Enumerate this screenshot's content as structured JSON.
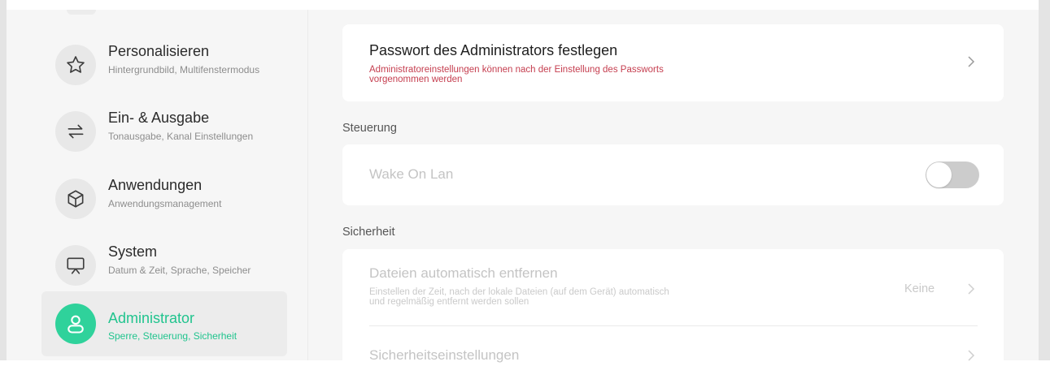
{
  "sidebar": {
    "items": [
      {
        "title": "Personalisieren",
        "subtitle": "Hintergrundbild, Multifenstermodus",
        "icon": "star-icon"
      },
      {
        "title": "Ein- & Ausgabe",
        "subtitle": "Tonausgabe, Kanal Einstellungen",
        "icon": "swap-arrows-icon"
      },
      {
        "title": "Anwendungen",
        "subtitle": "Anwendungsmanagement",
        "icon": "cube-icon"
      },
      {
        "title": "System",
        "subtitle": "Datum & Zeit, Sprache, Speicher",
        "icon": "presentation-screen-icon"
      },
      {
        "title": "Administrator",
        "subtitle": "Sperre, Steuerung, Sicherheit",
        "icon": "user-icon",
        "active": true
      }
    ]
  },
  "main": {
    "password_card": {
      "title": "Passwort des Administrators festlegen",
      "description": "Administratoreinstellungen können nach der Einstellung des Passworts vorgenommen werden"
    },
    "control_section": {
      "label": "Steuerung",
      "wake_on_lan": {
        "label": "Wake On Lan",
        "enabled": false
      }
    },
    "security_section": {
      "label": "Sicherheit",
      "auto_delete": {
        "title": "Dateien automatisch entfernen",
        "description": "Einstellen der Zeit, nach der lokale Dateien (auf dem Gerät) automatisch und regelmäßig entfernt werden sollen",
        "value": "Keine"
      },
      "security_settings": {
        "title": "Sicherheitseinstellungen"
      }
    }
  },
  "colors": {
    "accent": "#2fd29b",
    "warning_text": "#c53e4f",
    "background": "#f6f6f6"
  }
}
